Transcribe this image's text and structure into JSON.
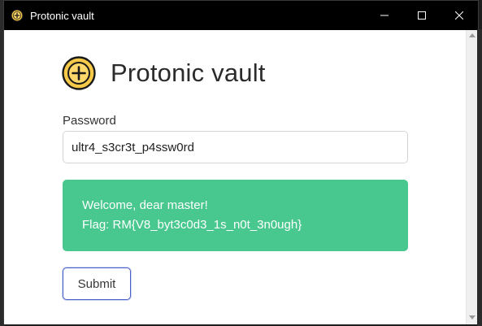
{
  "window": {
    "title": "Protonic vault",
    "controls": [
      "minimize",
      "maximize",
      "close"
    ]
  },
  "app": {
    "heading": "Protonic vault",
    "logo_icon": "plus-coin-icon",
    "accent_color": "#f7c948"
  },
  "form": {
    "password_label": "Password",
    "password_value": "ultr4_s3cr3t_p4ssw0rd",
    "submit_label": "Submit",
    "submit_border_color": "#485fc7"
  },
  "notification": {
    "line1": "Welcome, dear master!",
    "line2": "Flag: RM{V8_byt3c0d3_1s_n0t_3n0ugh}",
    "color": "#48c78e"
  }
}
